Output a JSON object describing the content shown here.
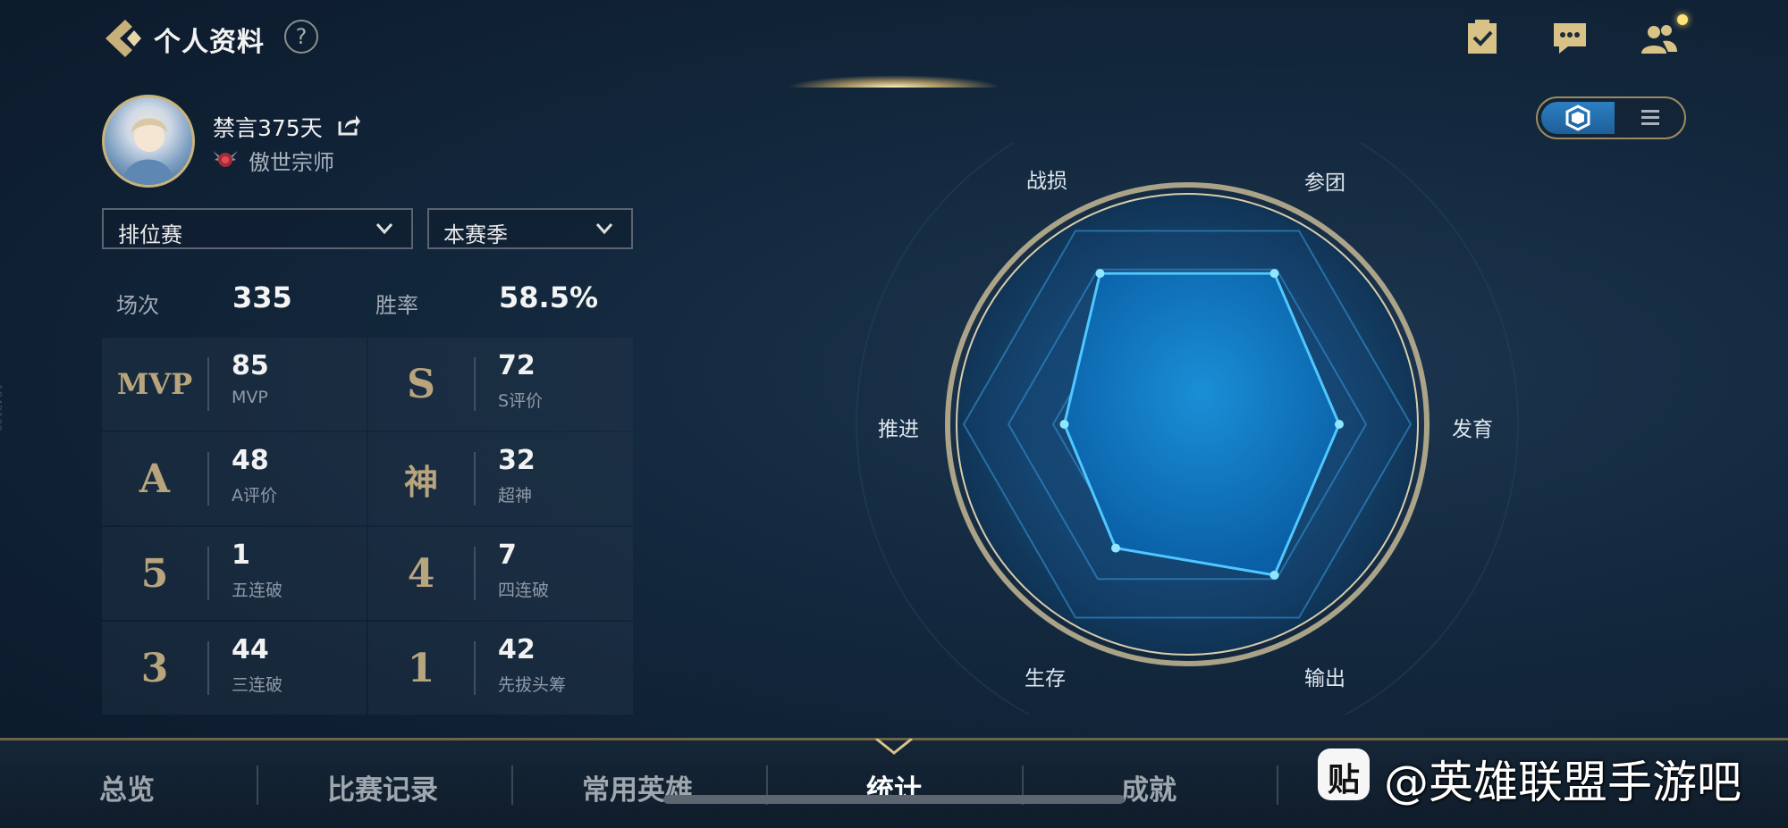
{
  "header": {
    "title": "个人资料",
    "help": "?"
  },
  "profile": {
    "username": "禁言375天",
    "rank_title": "傲世宗师"
  },
  "filters": {
    "mode": "排位赛",
    "season": "本赛季"
  },
  "summary": {
    "matches_label": "场次",
    "matches_value": "335",
    "winrate_label": "胜率",
    "winrate_value": "58.5%"
  },
  "stats": [
    {
      "badge": "MVP",
      "value": "85",
      "label": "MVP"
    },
    {
      "badge": "S",
      "value": "72",
      "label": "S评价"
    },
    {
      "badge": "A",
      "value": "48",
      "label": "A评价"
    },
    {
      "badge": "神",
      "value": "32",
      "label": "超神"
    },
    {
      "badge": "5",
      "value": "1",
      "label": "五连破"
    },
    {
      "badge": "4",
      "value": "7",
      "label": "四连破"
    },
    {
      "badge": "3",
      "value": "44",
      "label": "三连破"
    },
    {
      "badge": "1",
      "value": "42",
      "label": "先拔头筹"
    }
  ],
  "radar": {
    "axes": [
      "战损",
      "参团",
      "发育",
      "输出",
      "生存",
      "推进"
    ],
    "values": [
      0.78,
      0.78,
      0.68,
      0.78,
      0.64,
      0.55
    ]
  },
  "tabs": [
    {
      "label": "总览",
      "active": false
    },
    {
      "label": "比赛记录",
      "active": false
    },
    {
      "label": "常用英雄",
      "active": false
    },
    {
      "label": "统计",
      "active": true
    },
    {
      "label": "成就",
      "active": false
    }
  ],
  "watermark": {
    "logo": "贴",
    "text": "@英雄联盟手游吧"
  },
  "side_id": "1842109",
  "colors": {
    "accent_gold": "#c9b37c",
    "radar_blue": "#2aa7e6",
    "radar_point": "#8fe6ff"
  }
}
